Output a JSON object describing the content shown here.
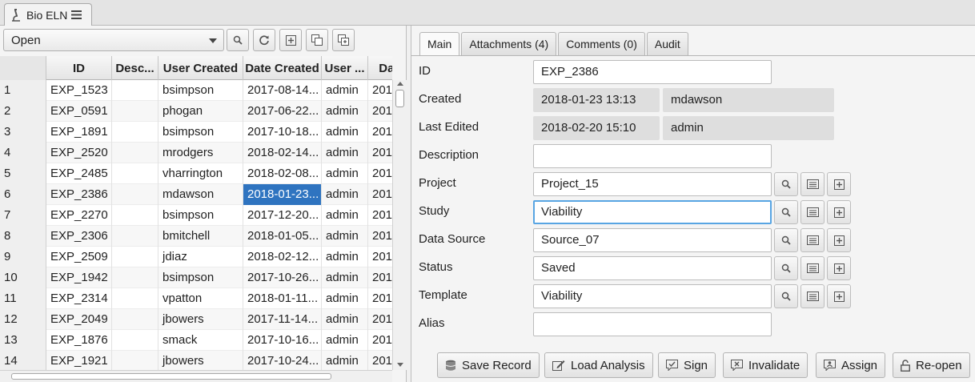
{
  "app_tab": {
    "title": "Bio ELN",
    "icon": "microscope-icon",
    "menu_icon": "hamburger-icon"
  },
  "left": {
    "filter": {
      "selected": "Open"
    },
    "toolbar": [
      "search-icon",
      "refresh-icon",
      "add-icon",
      "copy-icon",
      "duplicate-icon"
    ],
    "columns": [
      "",
      "ID",
      "Desc...",
      "User Created",
      "Date Created",
      "User ...",
      "Date"
    ],
    "rows": [
      [
        "1",
        "EXP_1523",
        "",
        "bsimpson",
        "2017-08-14...",
        "admin",
        "201"
      ],
      [
        "2",
        "EXP_0591",
        "",
        "phogan",
        "2017-06-22...",
        "admin",
        "201"
      ],
      [
        "3",
        "EXP_1891",
        "",
        "bsimpson",
        "2017-10-18...",
        "admin",
        "201"
      ],
      [
        "4",
        "EXP_2520",
        "",
        "mrodgers",
        "2018-02-14...",
        "admin",
        "201"
      ],
      [
        "5",
        "EXP_2485",
        "",
        "vharrington",
        "2018-02-08...",
        "admin",
        "201"
      ],
      [
        "6",
        "EXP_2386",
        "",
        "mdawson",
        "2018-01-23...",
        "admin",
        "201"
      ],
      [
        "7",
        "EXP_2270",
        "",
        "bsimpson",
        "2017-12-20...",
        "admin",
        "201"
      ],
      [
        "8",
        "EXP_2306",
        "",
        "bmitchell",
        "2018-01-05...",
        "admin",
        "201"
      ],
      [
        "9",
        "EXP_2509",
        "",
        "jdiaz",
        "2018-02-12...",
        "admin",
        "201"
      ],
      [
        "10",
        "EXP_1942",
        "",
        "bsimpson",
        "2017-10-26...",
        "admin",
        "201"
      ],
      [
        "11",
        "EXP_2314",
        "",
        "vpatton",
        "2018-01-11...",
        "admin",
        "201"
      ],
      [
        "12",
        "EXP_2049",
        "",
        "jbowers",
        "2017-11-14...",
        "admin",
        "201"
      ],
      [
        "13",
        "EXP_1876",
        "",
        "smack",
        "2017-10-16...",
        "admin",
        "201"
      ],
      [
        "14",
        "EXP_1921",
        "",
        "jbowers",
        "2017-10-24...",
        "admin",
        "201"
      ]
    ],
    "selected_row_index": 5,
    "selected_col_index": 4
  },
  "right": {
    "tabs": [
      "Main",
      "Attachments (4)",
      "Comments (0)",
      "Audit"
    ],
    "active_tab": 0,
    "labels": {
      "id": "ID",
      "created": "Created",
      "last_edited": "Last Edited",
      "description": "Description",
      "project": "Project",
      "study": "Study",
      "data_source": "Data Source",
      "status": "Status",
      "template": "Template",
      "alias": "Alias"
    },
    "values": {
      "id": "EXP_2386",
      "created_date": "2018-01-23 13:13",
      "created_user": "mdawson",
      "edited_date": "2018-02-20 15:10",
      "edited_user": "admin",
      "description": "",
      "project": "Project_15",
      "study": "Viability",
      "data_source": "Source_07",
      "status": "Saved",
      "template": "Viability",
      "alias": ""
    },
    "actions": {
      "save": "Save Record",
      "load": "Load Analysis",
      "sign": "Sign",
      "invalidate": "Invalidate",
      "assign": "Assign",
      "reopen": "Re-open"
    }
  }
}
